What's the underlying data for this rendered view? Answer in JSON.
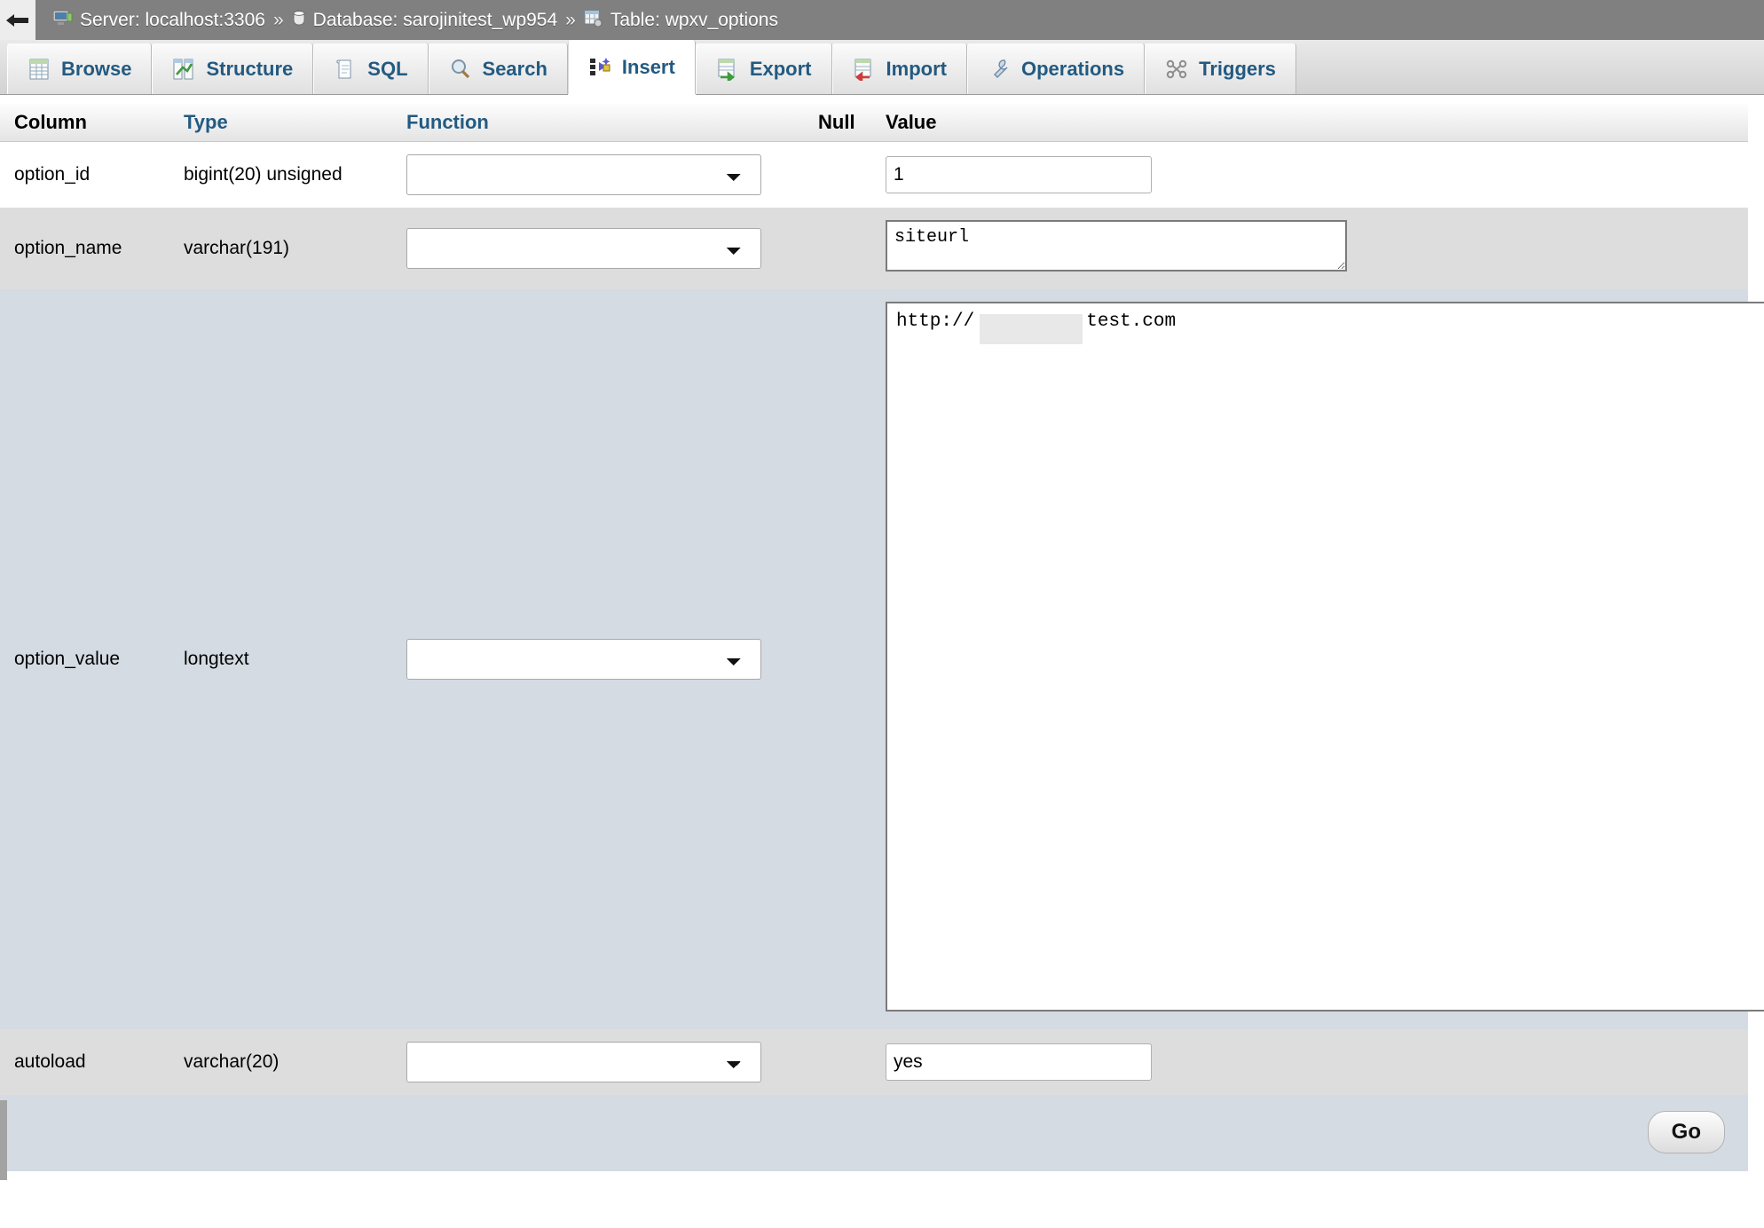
{
  "breadcrumb": {
    "back_label": "back-arrow",
    "items": [
      {
        "icon": "server-icon",
        "label": "Server: localhost:3306"
      },
      {
        "icon": "database-icon",
        "label": "Database: sarojinitest_wp954"
      },
      {
        "icon": "table-icon",
        "label": "Table: wpxv_options"
      }
    ],
    "separator": "»"
  },
  "tabs": [
    {
      "label": "Browse",
      "icon": "browse-icon",
      "active": false
    },
    {
      "label": "Structure",
      "icon": "structure-icon",
      "active": false
    },
    {
      "label": "SQL",
      "icon": "sql-icon",
      "active": false
    },
    {
      "label": "Search",
      "icon": "search-icon",
      "active": false
    },
    {
      "label": "Insert",
      "icon": "insert-icon",
      "active": true
    },
    {
      "label": "Export",
      "icon": "export-icon",
      "active": false
    },
    {
      "label": "Import",
      "icon": "import-icon",
      "active": false
    },
    {
      "label": "Operations",
      "icon": "wrench-icon",
      "active": false
    },
    {
      "label": "Triggers",
      "icon": "triggers-icon",
      "active": false
    }
  ],
  "table": {
    "headers": {
      "column": "Column",
      "type": "Type",
      "function": "Function",
      "null": "Null",
      "value": "Value"
    },
    "rows": [
      {
        "column": "option_id",
        "type": "bigint(20) unsigned",
        "function_selected": "",
        "null": "",
        "value": "1",
        "value_kind": "input"
      },
      {
        "column": "option_name",
        "type": "varchar(191)",
        "function_selected": "",
        "null": "",
        "value": "siteurl",
        "value_kind": "textarea-small"
      },
      {
        "column": "option_value",
        "type": "longtext",
        "function_selected": "",
        "null": "",
        "value": "http://          test.com",
        "value_kind": "textarea-large",
        "redacted": true
      },
      {
        "column": "autoload",
        "type": "varchar(20)",
        "function_selected": "",
        "null": "",
        "value": "yes",
        "value_kind": "input"
      }
    ]
  },
  "footer": {
    "go_label": "Go"
  },
  "colors": {
    "tab_text": "#235a81",
    "breadcrumb_bg": "#808080",
    "row_highlight": "#d4dbe3",
    "row_alt": "#dddddd"
  }
}
